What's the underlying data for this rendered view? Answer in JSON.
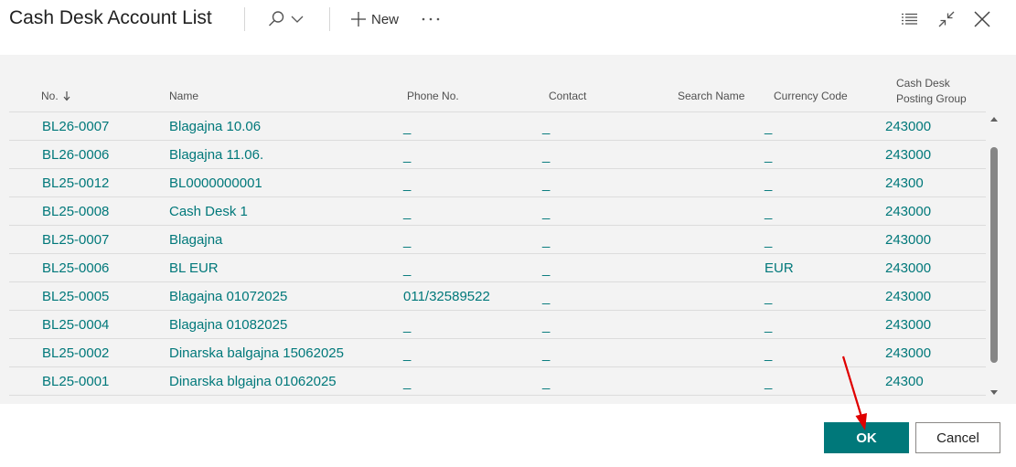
{
  "header": {
    "title": "Cash Desk Account List",
    "new_label": "New"
  },
  "columns": {
    "no": "No.",
    "name": "Name",
    "phone": "Phone No.",
    "contact": "Contact",
    "search": "Search Name",
    "currency": "Currency Code",
    "posting_line1": "Cash Desk",
    "posting_line2": "Posting Group"
  },
  "rows": [
    {
      "no": "BL26-0007",
      "name": "Blagajna 10.06",
      "phone": "_",
      "contact": "_",
      "currency": "_",
      "posting": "243000"
    },
    {
      "no": "BL26-0006",
      "name": "Blagajna 11.06.",
      "phone": "_",
      "contact": "_",
      "currency": "_",
      "posting": "243000"
    },
    {
      "no": "BL25-0012",
      "name": "BL0000000001",
      "phone": "_",
      "contact": "_",
      "currency": "_",
      "posting": "24300"
    },
    {
      "no": "BL25-0008",
      "name": "Cash Desk 1",
      "phone": "_",
      "contact": "_",
      "currency": "_",
      "posting": "243000"
    },
    {
      "no": "BL25-0007",
      "name": "Blagajna",
      "phone": "_",
      "contact": "_",
      "currency": "_",
      "posting": "243000"
    },
    {
      "no": "BL25-0006",
      "name": "BL EUR",
      "phone": "_",
      "contact": "_",
      "currency": "EUR",
      "posting": "243000"
    },
    {
      "no": "BL25-0005",
      "name": "Blagajna 01072025",
      "phone": "011/32589522",
      "contact": "_",
      "currency": "_",
      "posting": "243000"
    },
    {
      "no": "BL25-0004",
      "name": "Blagajna 01082025",
      "phone": "_",
      "contact": "_",
      "currency": "_",
      "posting": "243000"
    },
    {
      "no": "BL25-0002",
      "name": "Dinarska balgajna 15062025",
      "phone": "_",
      "contact": "_",
      "currency": "_",
      "posting": "243000"
    },
    {
      "no": "BL25-0001",
      "name": "Dinarska blgajna 01062025",
      "phone": "_",
      "contact": "_",
      "currency": "_",
      "posting": "24300"
    }
  ],
  "footer": {
    "ok_label": "OK",
    "cancel_label": "Cancel"
  },
  "colors": {
    "accent": "#00787a",
    "annotation_arrow": "#e00000"
  },
  "icons": [
    "search-icon",
    "chevron-down-icon",
    "plus-icon",
    "more-icon",
    "list-icon",
    "collapse-icon",
    "close-icon",
    "sort-down-icon",
    "scroll-up-icon",
    "scroll-down-icon"
  ]
}
